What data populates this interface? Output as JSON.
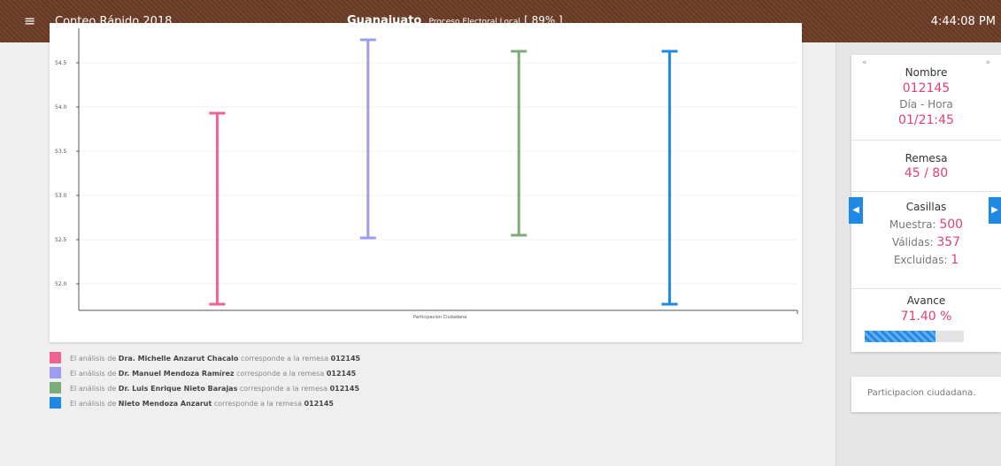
{
  "header": {
    "menu_icon": "hamburger-icon",
    "app_title": "Conteo Rápido 2018",
    "region": "Guanajuato",
    "process": "Proceso Electoral Local",
    "progress_text": "[ 89% ]",
    "clock": "4:44:08 PM"
  },
  "chart_data": {
    "type": "error-bar",
    "categories": [
      "Participacion Ciudadana"
    ],
    "xlabel": "Participacion Ciudadana",
    "ylim": [
      51.7,
      54.85
    ],
    "yticks": [
      52.0,
      52.5,
      53.0,
      53.5,
      54.0,
      54.5
    ],
    "ytick_labels": [
      "52.0",
      "52.5",
      "53.0",
      "53.5",
      "54.0",
      "54.5"
    ],
    "grid": true,
    "series": [
      {
        "low": 51.77,
        "high": 53.93,
        "color": "#f06292"
      },
      {
        "low": 52.52,
        "high": 54.76,
        "color": "#9c9cf0"
      },
      {
        "low": 52.55,
        "high": 54.63,
        "color": "#7cab7c"
      },
      {
        "low": 51.77,
        "high": 54.63,
        "color": "#1e88e5"
      }
    ]
  },
  "legend": [
    {
      "prefix": "El análisis de",
      "name": "Dra. Michelle Anzarut Chacalo",
      "middle": "corresponde a la remesa",
      "id": "012145",
      "color": "#f06292"
    },
    {
      "prefix": "El análisis de",
      "name": "Dr. Manuel Mendoza Ramírez",
      "middle": "corresponde a la remesa",
      "id": "012145",
      "color": "#9c9cf0"
    },
    {
      "prefix": "El análisis de",
      "name": "Dr. Luis Enrique Nieto Barajas",
      "middle": "corresponde a la remesa",
      "id": "012145",
      "color": "#7cab7c"
    },
    {
      "prefix": "El análisis de",
      "name": "Nieto Mendoza Anzarut",
      "middle": "corresponde a la remesa",
      "id": "012145",
      "color": "#1e88e5"
    }
  ],
  "info": {
    "nav_first": "«",
    "nav_last": "»",
    "nombre_label": "Nombre",
    "nombre_value": "012145",
    "dia_hora_label": "Día - Hora",
    "dia_hora_value": "01/21:45",
    "remesa_label": "Remesa",
    "remesa_value": "45 / 80",
    "casillas_label": "Casillas",
    "muestra_label": "Muestra:",
    "muestra_value": "500",
    "validas_label": "Válidas:",
    "validas_value": "357",
    "excluidas_label": "Excluidas:",
    "excluidas_value": "1",
    "avance_label": "Avance",
    "avance_value": "71.40 %",
    "avance_fraction": 0.714,
    "prev_icon": "caret-left-icon",
    "next_icon": "caret-right-icon"
  },
  "note": "Participacion ciudadana."
}
